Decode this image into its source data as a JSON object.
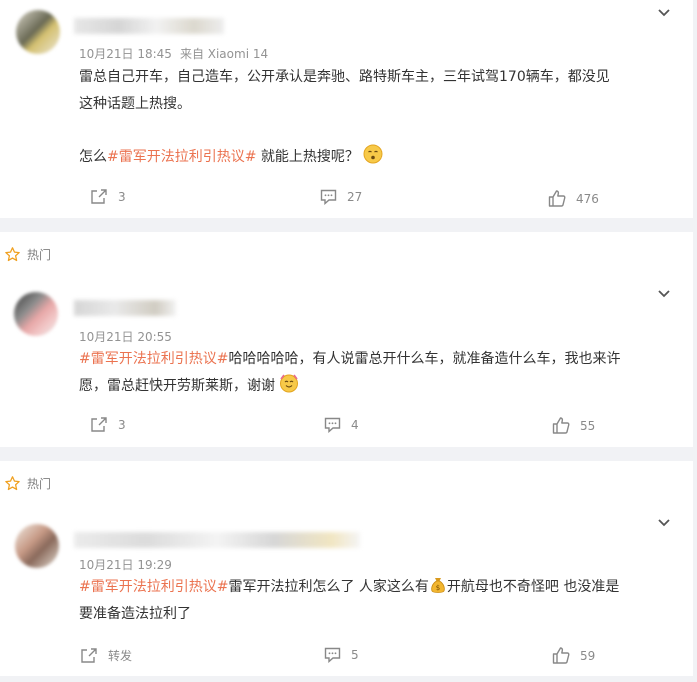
{
  "comments": [
    {
      "time": "10月21日 18:45",
      "device": "来自 Xiaomi 14",
      "text_line1": "雷总自己开车，自己造车，公开承认是奔驰、路特斯车主，三年试驾170辆车，都没见",
      "text_line2": "这种话题上热搜。",
      "line3_prefix": "怎么",
      "line3_topic": "#雷军开法拉利引热议#",
      "line3_suffix": " 就能上热搜呢？",
      "shares": "3",
      "comments": "27",
      "likes": "476"
    },
    {
      "badge": "热门",
      "time": "10月21日 20:55",
      "topic": "#雷军开法拉利引热议#",
      "text_line1_rest": "哈哈哈哈哈，有人说雷总开什么车，就准备造什么车，我也来许",
      "text_line2": "愿，雷总赶快开劳斯莱斯，谢谢",
      "shares": "3",
      "comments": "4",
      "likes": "55"
    },
    {
      "badge": "热门",
      "time": "10月21日 19:29",
      "topic": "#雷军开法拉利引热议#",
      "text_line1_a": "雷军开法拉利怎么了 人家这么有",
      "text_line1_b": "开航母也不奇怪吧 也没准是",
      "text_line2": "要准备造法拉利了",
      "shares": "转发",
      "comments": "5",
      "likes": "59"
    }
  ],
  "colors": {
    "topic": "#eb7350",
    "meta": "#939393",
    "background": "#f1f2f5"
  },
  "icons": [
    "chevron-down-icon",
    "share-icon",
    "comment-icon",
    "like-icon",
    "star-icon",
    "emoji-icon",
    "money-bag-icon"
  ]
}
